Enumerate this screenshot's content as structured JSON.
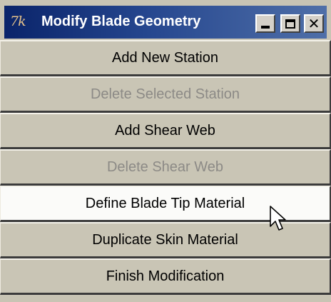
{
  "window": {
    "icon_text": "7k",
    "title": "Modify Blade Geometry",
    "controls": {
      "minimize": "minimize-icon",
      "maximize": "maximize-icon",
      "close": "close-icon"
    }
  },
  "menu": {
    "items": [
      {
        "label": "Add New Station",
        "state": "enabled"
      },
      {
        "label": "Delete Selected Station",
        "state": "disabled"
      },
      {
        "label": "Add Shear Web",
        "state": "enabled"
      },
      {
        "label": "Delete Shear Web",
        "state": "disabled"
      },
      {
        "label": "Define Blade Tip Material",
        "state": "hovered"
      },
      {
        "label": "Duplicate Skin Material",
        "state": "enabled"
      },
      {
        "label": "Finish Modification",
        "state": "enabled"
      }
    ]
  },
  "cursor": {
    "icon": "mouse-pointer-icon"
  },
  "colors": {
    "titlebar_start": "#0a246a",
    "titlebar_end": "#4f6fa8",
    "button_face": "#c9c5b5",
    "hover_face": "#fbfbf9",
    "disabled_text": "#8c8a86"
  }
}
